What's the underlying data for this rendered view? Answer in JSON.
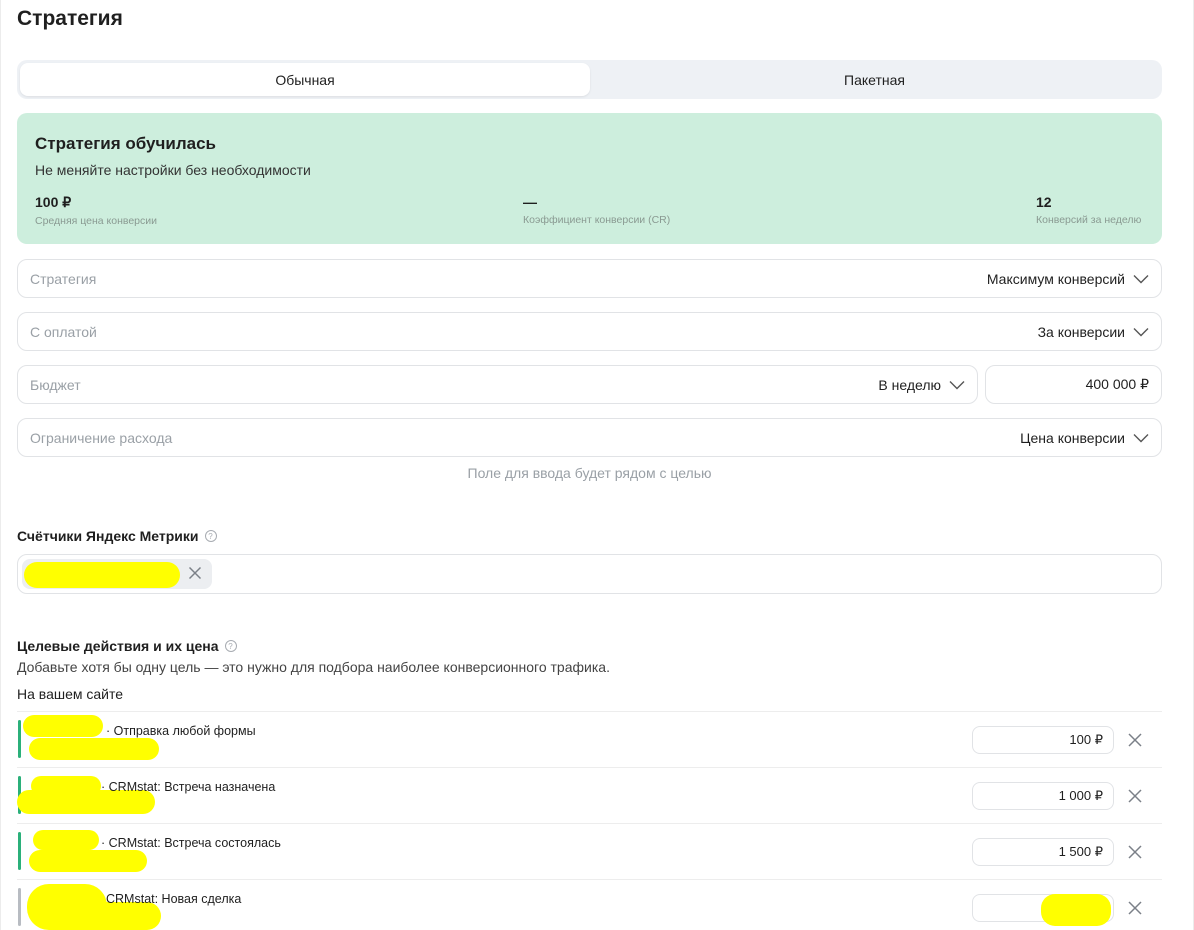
{
  "page_title": "Стратегия",
  "tabs": {
    "regular": "Обычная",
    "batch": "Пакетная"
  },
  "status": {
    "title": "Стратегия обучилась",
    "subtitle": "Не меняйте настройки без необходимости",
    "metrics": [
      {
        "value": "100 ₽",
        "label": "Средняя цена конверсии"
      },
      {
        "value": "—",
        "label": "Коэффициент конверсии (CR)"
      },
      {
        "value": "12",
        "label": "Конверсий за неделю"
      }
    ]
  },
  "fields": {
    "strategy": {
      "label": "Стратегия",
      "value": "Максимум конверсий"
    },
    "payment": {
      "label": "С оплатой",
      "value": "За конверсии"
    },
    "budget": {
      "label": "Бюджет",
      "period": "В неделю",
      "amount": "400 000 ₽"
    },
    "limit": {
      "label": "Ограничение расхода",
      "value": "Цена конверсии"
    }
  },
  "limit_hint": "Поле для ввода будет рядом с целью",
  "counters": {
    "heading": "Счётчики Яндекс Метрики",
    "help": "?"
  },
  "goals": {
    "heading": "Целевые действия и их цена",
    "help": "?",
    "description": "Добавьте хотя бы одну цель — это нужно для подбора наиболее конверсионного трафика.",
    "on_site": "На вашем сайте",
    "items": [
      {
        "name": "· Отправка любой формы",
        "price": "100 ₽"
      },
      {
        "name": "· CRMstat: Встреча назначена",
        "price": "1 000 ₽"
      },
      {
        "name": "· CRMstat: Встреча состоялась",
        "price": "1 500 ₽"
      },
      {
        "name": "CRMstat: Новая сделка",
        "price": ""
      }
    ]
  },
  "colors": {
    "accent_green": "#2bb07a",
    "status_bg": "#cdeedd",
    "redaction": "#ffff00",
    "inactive_bar": "#b8bcc2"
  }
}
